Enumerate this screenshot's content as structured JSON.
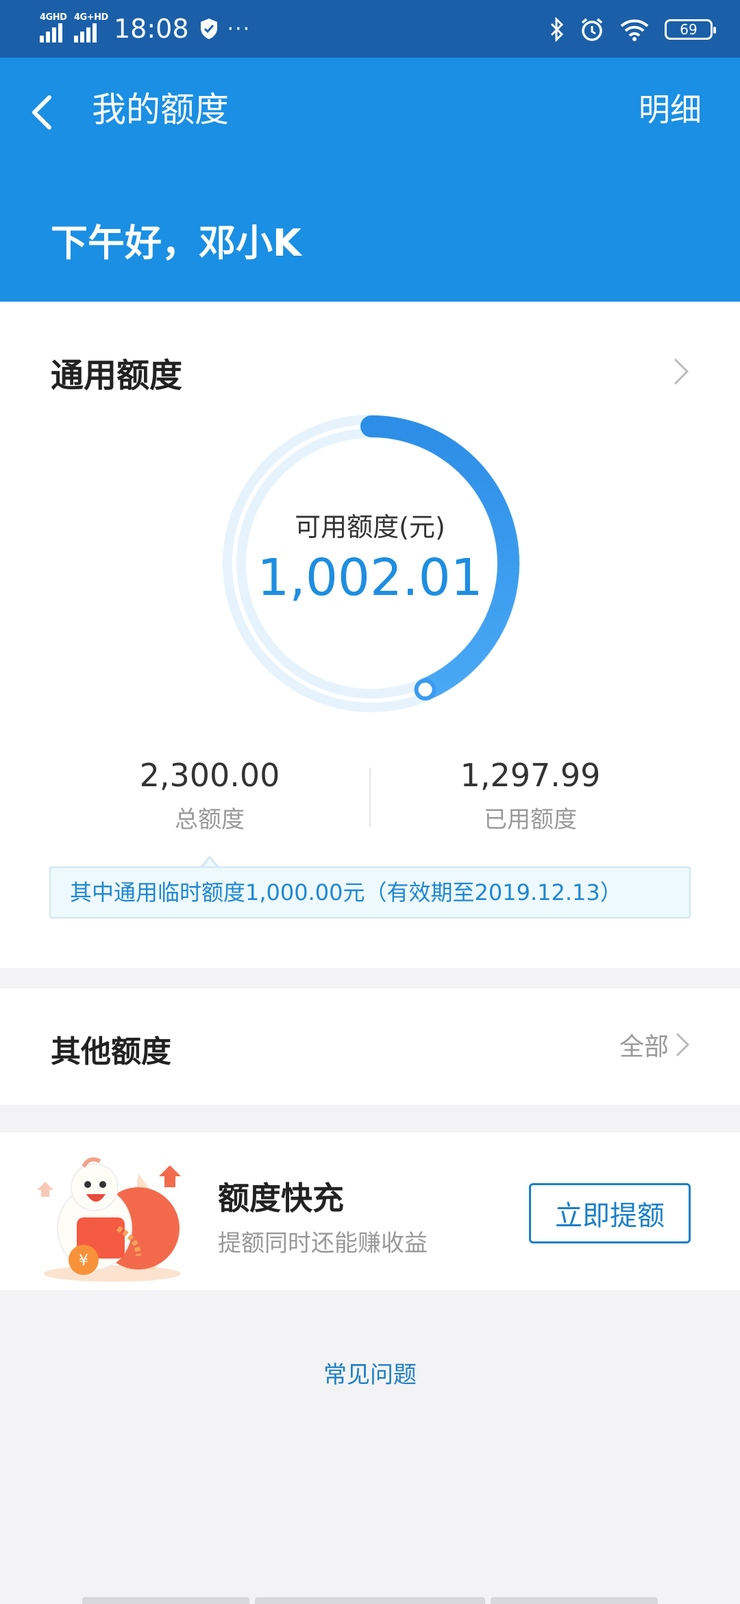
{
  "status_bar": {
    "network_1": "4GHD",
    "network_2": "4G+HD",
    "time": "18:08",
    "dots": "···",
    "battery": "69"
  },
  "header": {
    "title": "我的额度",
    "detail_link": "明细",
    "greeting": "下午好，邓小K"
  },
  "general_quota": {
    "title": "通用额度",
    "available_label": "可用额度(元)",
    "available_value": "1,002.01",
    "available_ratio": 0.4357,
    "total_value": "2,300.00",
    "total_label": "总额度",
    "used_value": "1,297.99",
    "used_label": "已用额度",
    "temp_notice": "其中通用临时额度1,000.00元（有效期至2019.12.13）"
  },
  "other_quota": {
    "title": "其他额度",
    "all_link": "全部"
  },
  "promo": {
    "title": "额度快充",
    "subtitle": "提额同时还能赚收益",
    "button_label": "立即提额"
  },
  "faq_link": "常见问题",
  "colors": {
    "status_bar": "#1a5fa8",
    "header": "#1a8fe3",
    "accent": "#1e8ee0",
    "ring_track": "#e3f2fd"
  }
}
